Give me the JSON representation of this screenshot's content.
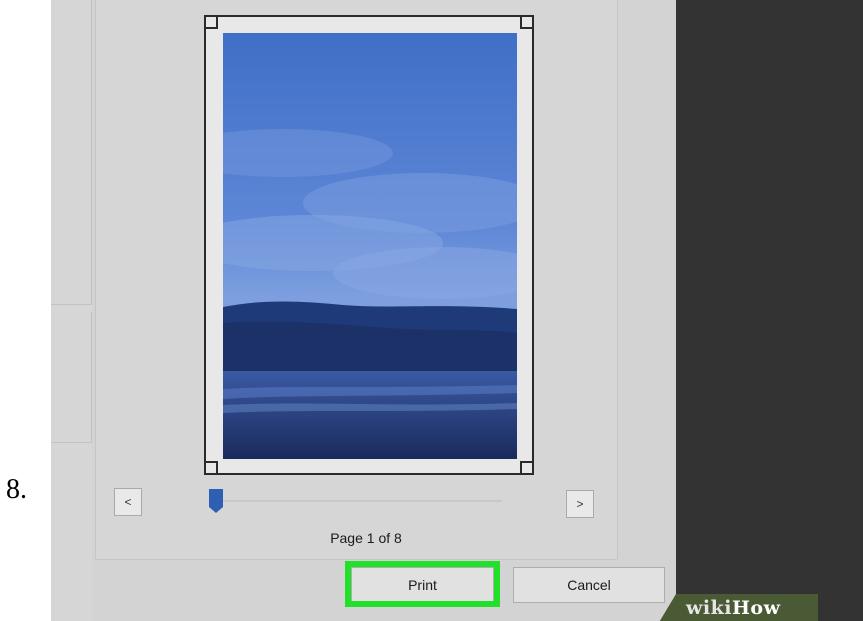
{
  "step": {
    "number": "8."
  },
  "preview": {
    "prev_label": "<",
    "next_label": ">",
    "page_indicator": "Page 1 of 8",
    "current_page": 1,
    "total_pages": 8
  },
  "actions": {
    "print_label": "Print",
    "cancel_label": "Cancel"
  },
  "branding": {
    "wiki": "wiki",
    "how": "How"
  },
  "colors": {
    "highlight": "#22e02a",
    "slider_thumb": "#2f5fb3",
    "dark_panel": "#333333"
  }
}
